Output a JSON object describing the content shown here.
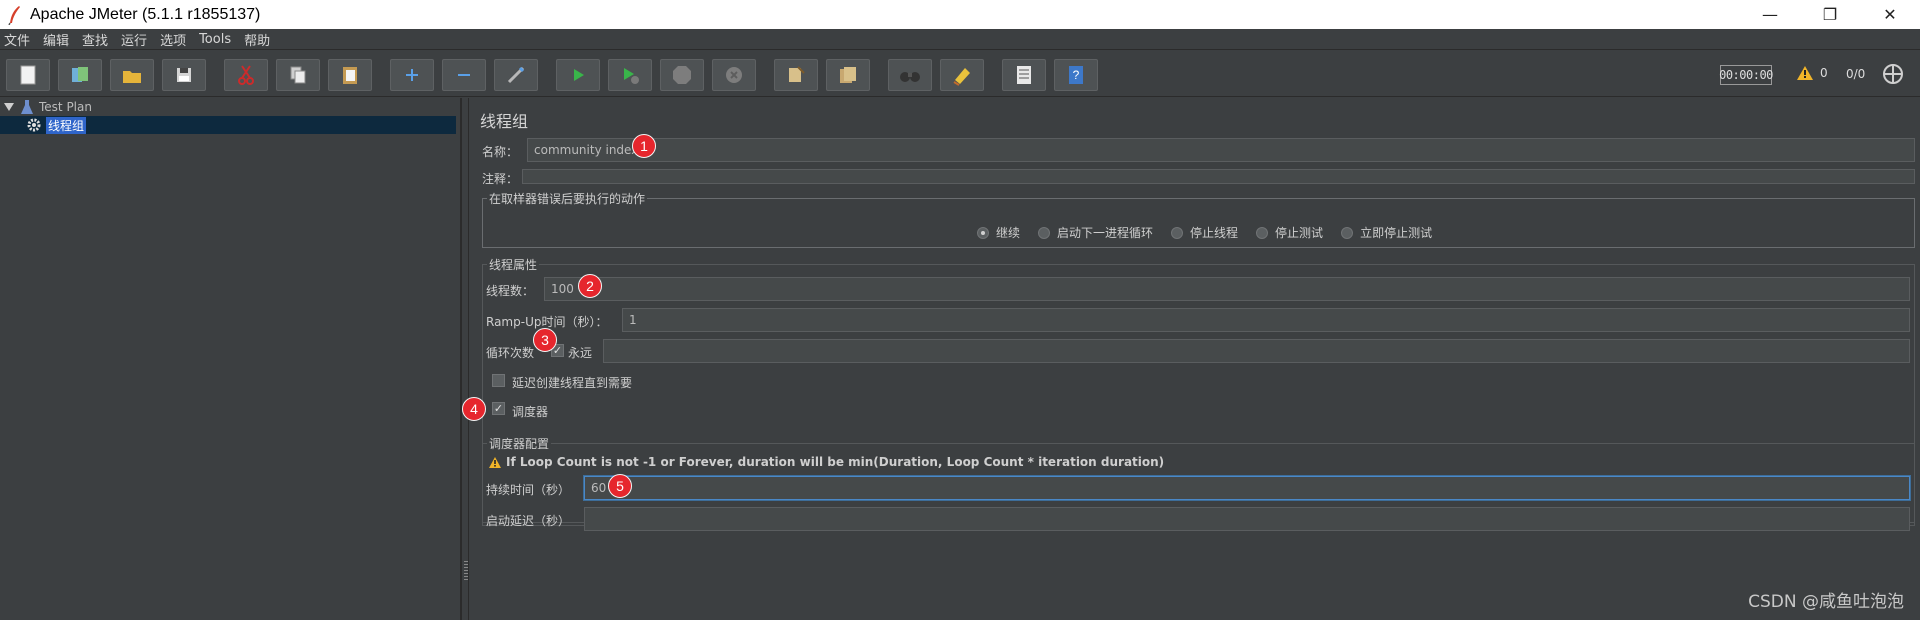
{
  "window": {
    "title": "Apache JMeter (5.1.1 r1855137)",
    "controls": {
      "minimize": "—",
      "restore": "❐",
      "close": "✕"
    }
  },
  "menu": [
    "文件",
    "编辑",
    "查找",
    "运行",
    "选项",
    "Tools",
    "帮助"
  ],
  "toolbar": {
    "timer": "00:00:00",
    "warning_count": "0",
    "thread_ratio": "0/0"
  },
  "tree": {
    "root": "Test Plan",
    "child": "线程组"
  },
  "panel": {
    "title": "线程组",
    "name_label": "名称：",
    "name_value": "community index",
    "comment_label": "注释：",
    "comment_value": "",
    "on_error": {
      "legend": "在取样器错误后要执行的动作",
      "options": [
        "继续",
        "启动下一进程循环",
        "停止线程",
        "停止测试",
        "立即停止测试"
      ],
      "selected": "继续"
    },
    "thread_props": {
      "legend": "线程属性",
      "threads_label": "线程数：",
      "threads_value": "100",
      "rampup_label": "Ramp-Up时间（秒）：",
      "rampup_value": "1",
      "loop_label": "循环次数",
      "forever_label": "永远",
      "forever_checked": true,
      "loop_value": "",
      "delay_label": "延迟创建线程直到需要",
      "delay_checked": false,
      "scheduler_label": "调度器",
      "scheduler_checked": true
    },
    "scheduler": {
      "legend": "调度器配置",
      "warning": "If Loop Count is not -1 or Forever, duration will be min(Duration, Loop Count * iteration duration)",
      "duration_label": "持续时间（秒）",
      "duration_value": "60",
      "startup_delay_label": "启动延迟（秒）",
      "startup_delay_value": ""
    }
  },
  "annotations": [
    "1",
    "2",
    "3",
    "4",
    "5"
  ],
  "watermark": "CSDN @咸鱼吐泡泡",
  "colors": {
    "background": "#3c3f41",
    "badge": "#e6262d",
    "selection": "#2f65ca",
    "focus_border": "#4a88c7"
  }
}
